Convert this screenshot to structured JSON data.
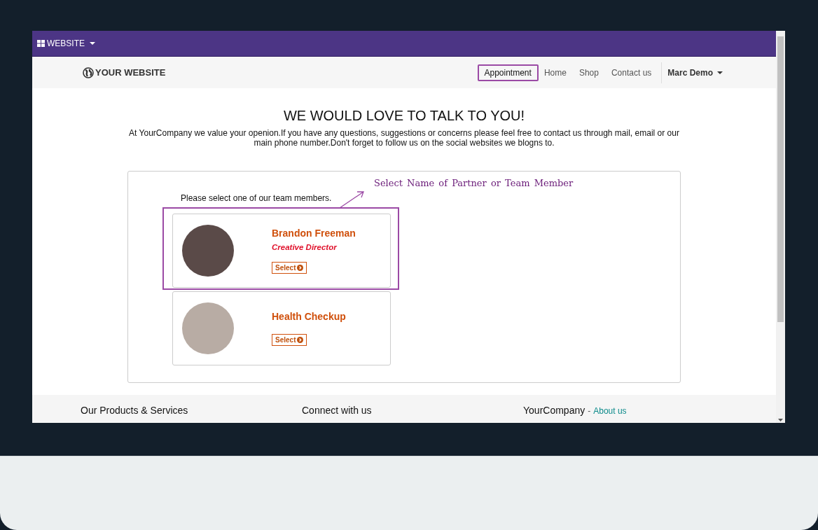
{
  "admin_bar": {
    "menu": "WEBSITE"
  },
  "header": {
    "logo": "YOUR WEBSITE",
    "nav": [
      {
        "label": "Appointment",
        "selected": true
      },
      {
        "label": "Home",
        "selected": false
      },
      {
        "label": "Shop",
        "selected": false
      },
      {
        "label": "Contact us",
        "selected": false
      }
    ],
    "user": "Marc Demo"
  },
  "intro": {
    "title": "WE WOULD LOVE TO TALK TO YOU!",
    "text": "At YourCompany we value your openion.If you have any questions, suggestions or concerns please feel free to contact us through mail, email or our main phone number.Don't forget to follow us on the social websites we blogns to."
  },
  "selection": {
    "prompt": "Please select one of our team members.",
    "annotation": "Select Name of Partner or Team Member",
    "cards": [
      {
        "name": "Brandon Freeman",
        "role": "Creative Director",
        "button": "Select",
        "highlighted": true
      },
      {
        "name": "Health Checkup",
        "button": "Select",
        "highlighted": false
      }
    ]
  },
  "footer": {
    "columns": [
      {
        "title": "Our Products & Services"
      },
      {
        "title": "Connect with us"
      },
      {
        "title": "YourCompany",
        "separator": "-",
        "link": "About us"
      }
    ]
  }
}
